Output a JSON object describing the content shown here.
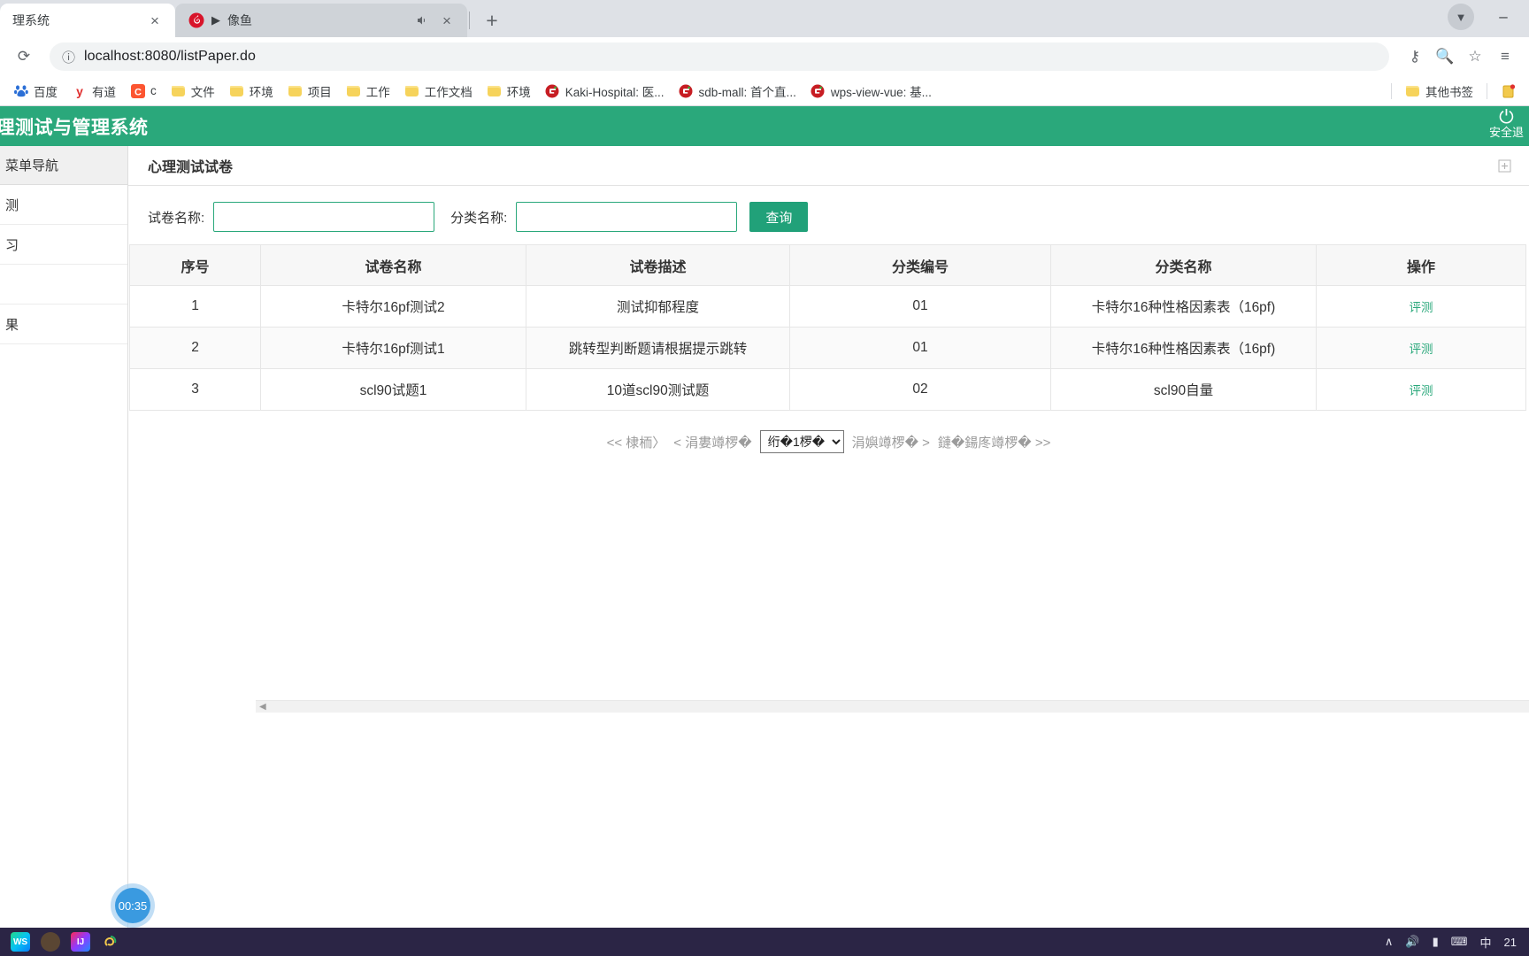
{
  "browser": {
    "tabs": [
      {
        "title": "理系统",
        "active": true,
        "close_label": "×",
        "favicon": "none"
      },
      {
        "title": "像鱼",
        "active": false,
        "close_label": "×",
        "favicon": "netease-music-icon",
        "play_glyph": "▶",
        "mute_glyph": "🔊"
      }
    ],
    "new_tab_label": "+",
    "window_controls": {
      "minimize": "–",
      "profile": "▼"
    },
    "toolbar": {
      "reload_glyph": "⟳",
      "info_glyph": "ⓘ",
      "url": "localhost:8080/listPaper.do",
      "key_glyph": "⚷",
      "zoom_glyph": "🔍",
      "star_glyph": "☆",
      "menu_glyph": "≡"
    },
    "bookmarks": [
      {
        "label": "百度",
        "icon": "baidu-icon"
      },
      {
        "label": "有道",
        "icon": "youdao-icon"
      },
      {
        "label": "c",
        "icon": "csdn-icon"
      },
      {
        "label": "文件",
        "icon": "folder-icon"
      },
      {
        "label": "环境",
        "icon": "folder-icon"
      },
      {
        "label": "项目",
        "icon": "folder-icon"
      },
      {
        "label": "工作",
        "icon": "folder-icon"
      },
      {
        "label": "工作文档",
        "icon": "folder-icon"
      },
      {
        "label": "环境",
        "icon": "folder-icon"
      },
      {
        "label": "Kaki-Hospital: 医...",
        "icon": "gitee-icon"
      },
      {
        "label": "sdb-mall: 首个直...",
        "icon": "gitee-icon"
      },
      {
        "label": "wps-view-vue: 基...",
        "icon": "gitee-icon"
      }
    ],
    "bookmarks_right": [
      {
        "label": "其他书签",
        "icon": "folder-icon"
      },
      {
        "label": "",
        "icon": "reading-list-icon"
      }
    ]
  },
  "app": {
    "header_title": "心理测试与管理系统",
    "logout_label": "安全退",
    "power_icon": "power-icon"
  },
  "sidebar": {
    "heading": "菜单导航",
    "items": [
      {
        "label": "测"
      },
      {
        "label": "习"
      },
      {
        "label": ""
      },
      {
        "label": "果"
      }
    ]
  },
  "panel": {
    "title": "心理测试试卷",
    "tool_icon": "expand-icon"
  },
  "filters": {
    "paper_name_label": "试卷名称:",
    "paper_name_value": "",
    "paper_name_placeholder": "",
    "category_name_label": "分类名称:",
    "category_name_value": "",
    "category_name_placeholder": "",
    "search_button": "查询"
  },
  "table": {
    "columns": [
      "序号",
      "试卷名称",
      "试卷描述",
      "分类编号",
      "分类名称",
      "操作"
    ],
    "rows": [
      {
        "index": "1",
        "paper_name": "卡特尔16pf测试2",
        "description": "测试抑郁程度",
        "category_code": "01",
        "category_name": "卡特尔16种性格因素表（16pf)",
        "action": "评测"
      },
      {
        "index": "2",
        "paper_name": "卡特尔16pf测试1",
        "description": "跳转型判断题请根据提示跳转",
        "category_code": "01",
        "category_name": "卡特尔16种性格因素表（16pf)",
        "action": "评测"
      },
      {
        "index": "3",
        "paper_name": "scl90试题1",
        "description": "10道scl90测试题",
        "category_code": "02",
        "category_name": "scl90自量",
        "action": "评测"
      }
    ]
  },
  "pagination": {
    "first": "<< 棣栭〉",
    "prev": "< 涓婁竴椤�",
    "select_value": "绗�1椤�",
    "next": "涓嬩竴椤� >",
    "last": "鏈�鍚庝竴椤� >>"
  },
  "hscrollbar": {
    "left_arrow": "◀",
    "right_arrow": "▶"
  },
  "timer_badge": "00:35",
  "taskbar": {
    "apps": [
      {
        "name": "webstorm-icon",
        "label": "WS"
      },
      {
        "name": "user-avatar-icon",
        "label": ""
      },
      {
        "name": "intellij-idea-icon",
        "label": "IJ"
      },
      {
        "name": "browser-icon",
        "label": ""
      }
    ],
    "tray": [
      {
        "name": "chevron-up-icon",
        "label": "∧"
      },
      {
        "name": "network-icon",
        "label": "🔊"
      },
      {
        "name": "battery-icon",
        "label": "▮"
      },
      {
        "name": "keyboard-icon",
        "label": "⌨"
      },
      {
        "name": "ime-indicator",
        "label": "中"
      },
      {
        "name": "clock",
        "label": "21"
      }
    ]
  }
}
